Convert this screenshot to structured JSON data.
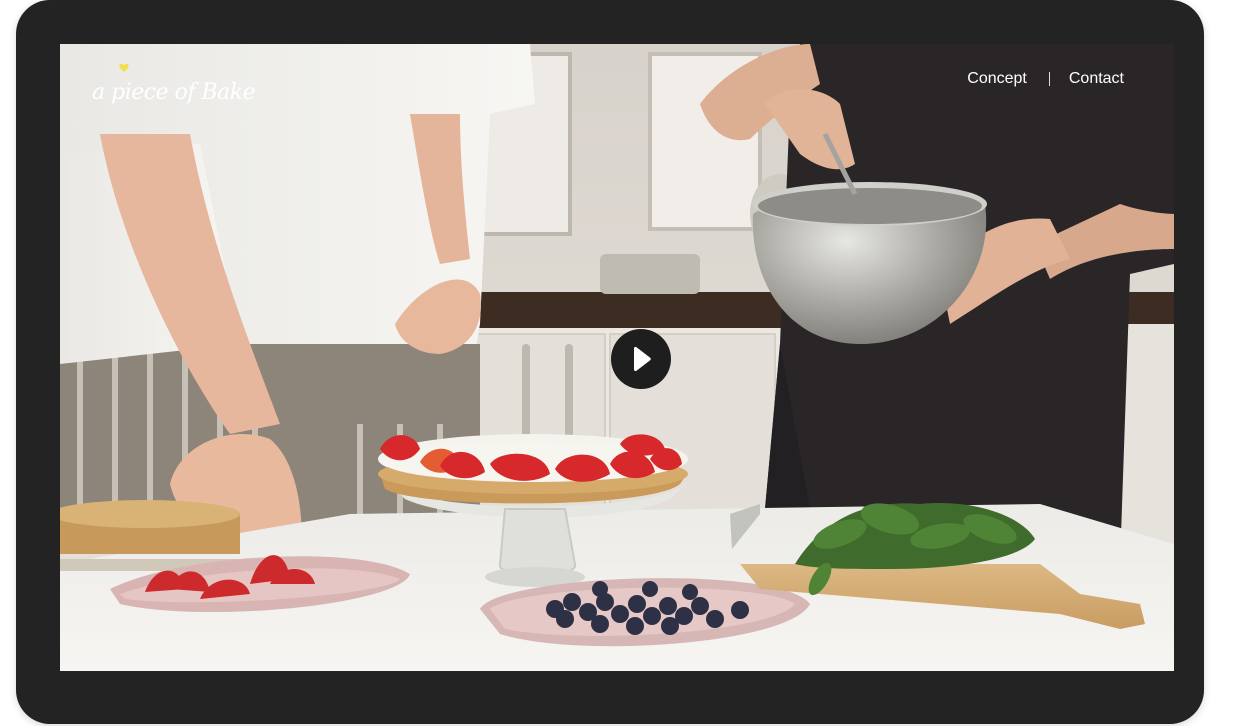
{
  "header": {
    "logo_text": "a piece of Bake",
    "nav": [
      {
        "label": "Concept"
      },
      {
        "label": "Contact"
      }
    ]
  },
  "video": {
    "play_icon": "play-icon",
    "state": "paused"
  },
  "colors": {
    "frame": "#232323",
    "logo_heart": "#f2df4b",
    "text": "#ffffff",
    "play_button": "#1e1e1e"
  }
}
